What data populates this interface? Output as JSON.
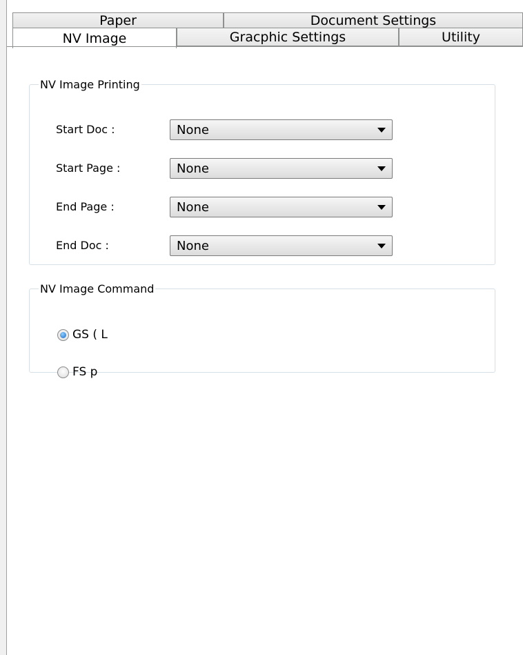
{
  "tabs": {
    "back_row": [
      {
        "label": "Paper"
      },
      {
        "label": "Document Settings"
      }
    ],
    "front_row": [
      {
        "label": "NV Image",
        "active": true
      },
      {
        "label": "Gracphic Settings"
      },
      {
        "label": "Utility"
      }
    ]
  },
  "nv_image_printing": {
    "legend": "NV Image Printing",
    "rows": [
      {
        "label": "Start Doc :",
        "value": "None"
      },
      {
        "label": "Start Page :",
        "value": "None"
      },
      {
        "label": "End Page :",
        "value": "None"
      },
      {
        "label": "End Doc :",
        "value": "None"
      }
    ]
  },
  "nv_image_command": {
    "legend": "NV Image Command",
    "options": [
      {
        "label": "GS ( L",
        "checked": true
      },
      {
        "label": "FS p",
        "checked": false
      }
    ]
  },
  "icons": {
    "dropdown": "chevron-down-icon"
  },
  "colors": {
    "radio_selected": "#1a66c6",
    "groupbox_border": "#d5dfe5",
    "tab_border": "#8e8f8f"
  }
}
